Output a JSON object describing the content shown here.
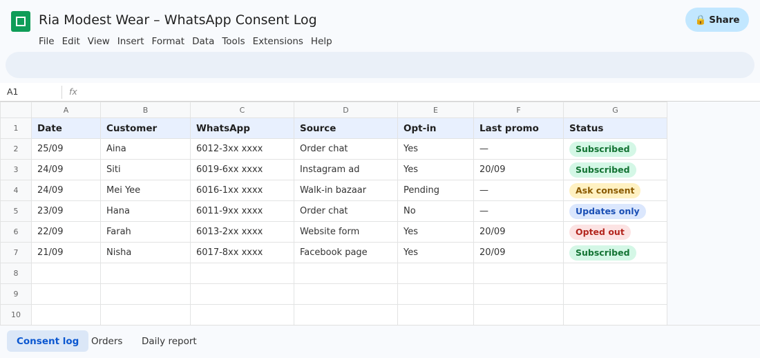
{
  "app": {
    "title": "Ria Modest Wear – WhatsApp Consent Log",
    "share_label": "Share",
    "share_icon": "🔒"
  },
  "menu": [
    "File",
    "Edit",
    "View",
    "Insert",
    "Format",
    "Data",
    "Tools",
    "Extensions",
    "Help"
  ],
  "formula_bar": {
    "cell_ref": "A1",
    "fx": "fx"
  },
  "columns": [
    "A",
    "B",
    "C",
    "D",
    "E",
    "F",
    "G"
  ],
  "row_numbers": [
    "1",
    "2",
    "3",
    "4",
    "5",
    "6",
    "7",
    "8",
    "9",
    "10"
  ],
  "headers": [
    "Date",
    "Customer",
    "WhatsApp",
    "Source",
    "Opt-in",
    "Last promo",
    "Status"
  ],
  "rows": [
    {
      "date": "25/09",
      "customer": "Aina",
      "whatsapp": "6012-3xx xxxx",
      "source": "Order chat",
      "optin": "Yes",
      "last_promo": "—",
      "status": "Subscribed",
      "status_kind": "green"
    },
    {
      "date": "24/09",
      "customer": "Siti",
      "whatsapp": "6019-6xx xxxx",
      "source": "Instagram ad",
      "optin": "Yes",
      "last_promo": "20/09",
      "status": "Subscribed",
      "status_kind": "green"
    },
    {
      "date": "24/09",
      "customer": "Mei Yee",
      "whatsapp": "6016-1xx xxxx",
      "source": "Walk-in bazaar",
      "optin": "Pending",
      "last_promo": "—",
      "status": "Ask consent",
      "status_kind": "amber"
    },
    {
      "date": "23/09",
      "customer": "Hana",
      "whatsapp": "6011-9xx xxxx",
      "source": "Order chat",
      "optin": "No",
      "last_promo": "—",
      "status": "Updates only",
      "status_kind": "blue"
    },
    {
      "date": "22/09",
      "customer": "Farah",
      "whatsapp": "6013-2xx xxxx",
      "source": "Website form",
      "optin": "Yes",
      "last_promo": "20/09",
      "status": "Opted out",
      "status_kind": "red"
    },
    {
      "date": "21/09",
      "customer": "Nisha",
      "whatsapp": "6017-8xx xxxx",
      "source": "Facebook page",
      "optin": "Yes",
      "last_promo": "20/09",
      "status": "Subscribed",
      "status_kind": "green"
    }
  ],
  "sheet_tabs": [
    {
      "label": "Consent log",
      "active": true
    },
    {
      "label": "Orders",
      "active": false
    },
    {
      "label": "Daily report",
      "active": false
    }
  ],
  "colors": {
    "accent": "#0f9d58",
    "share_bg": "#c2e7ff",
    "header_bg": "#e8f0fe",
    "active_tab": "#0b57d0"
  }
}
